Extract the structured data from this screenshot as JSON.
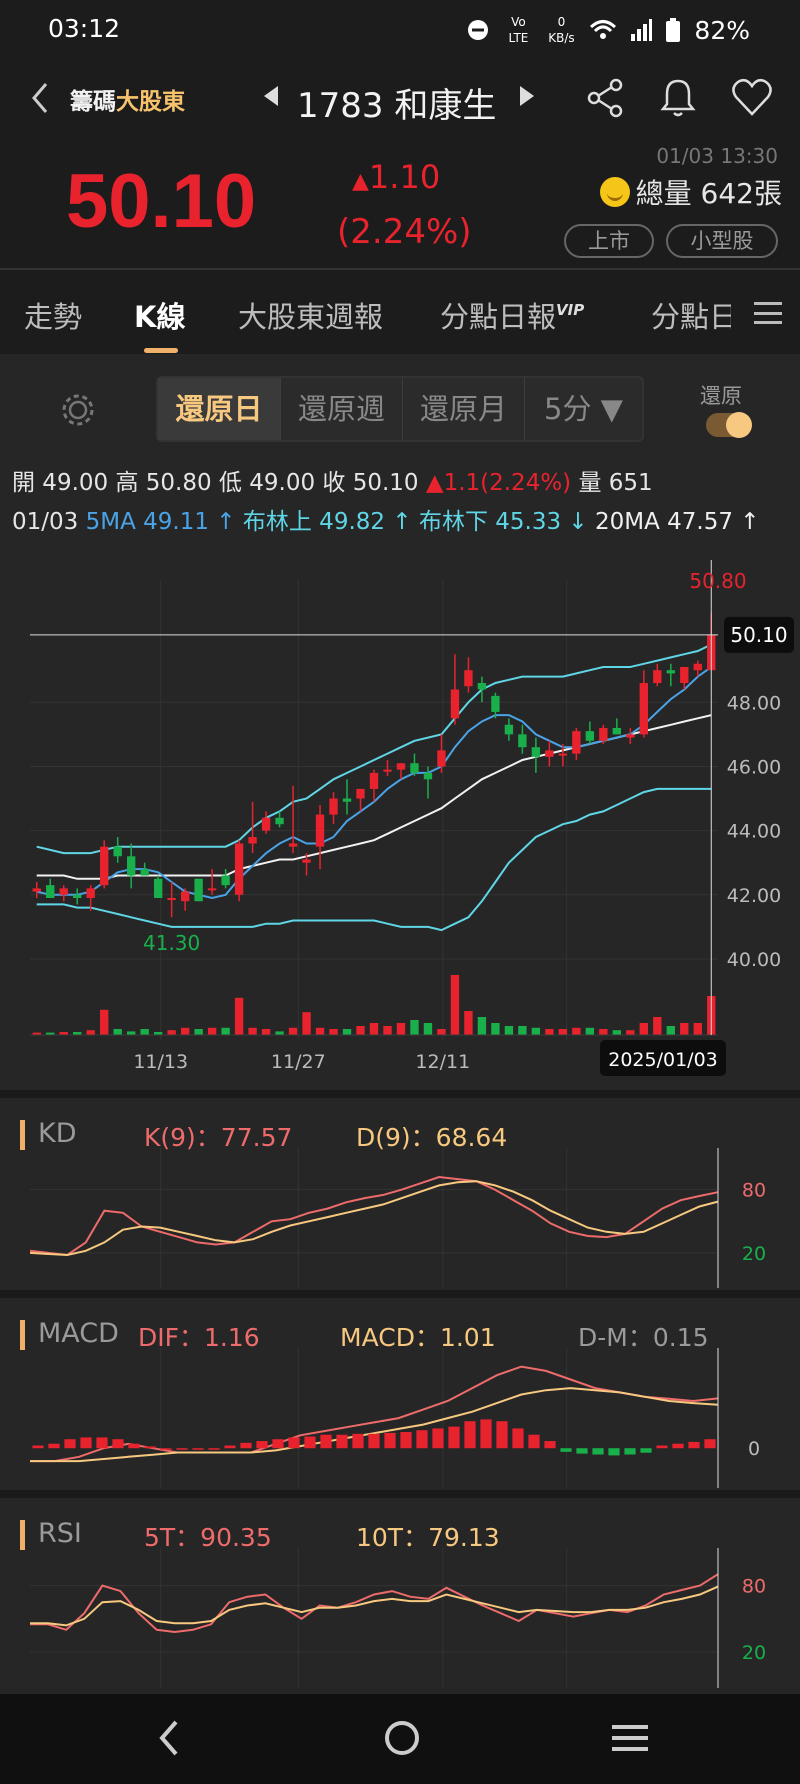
{
  "status": {
    "time": "03:12",
    "net1": "Vo LTE",
    "net2": "0 KB/s",
    "battery": "82%"
  },
  "header": {
    "brand_a": "籌碼",
    "brand_b": "大股東",
    "stock": "1783 和康生"
  },
  "quote": {
    "price": "50.10",
    "change": "1.10",
    "percent": "(2.24%)",
    "time": "01/03 13:30",
    "volume": "總量  642張",
    "tag1": "上市",
    "tag2": "小型股"
  },
  "tabs": [
    "走勢",
    "K線",
    "大股東週報",
    "分點日報",
    "VIP",
    "分點日"
  ],
  "segments": {
    "s1": "還原日",
    "s2": "還原週",
    "s3": "還原月",
    "s4": "5分 ▼",
    "restore": "還原"
  },
  "info": {
    "ohlc": "開 49.00 高 50.80 低 49.00 收 50.10 ",
    "chg": "▲1.1(2.24%)",
    "vol": " 量 651",
    "date": "01/03",
    "ma5": "5MA 49.11 ↑",
    "bbu": "布林上 49.82 ↑",
    "bbl": "布林下 45.33 ↓",
    "ma20": "20MA 47.57 ↑"
  },
  "kd": {
    "title": "KD",
    "k": "K(9)：77.57",
    "d": "D(9)：68.64",
    "t80": "80",
    "t20": "20"
  },
  "macd": {
    "title": "MACD",
    "dif": "DIF：1.16",
    "macd": "MACD：1.01",
    "dm": "D-M：0.15",
    "t0": "0"
  },
  "rsi": {
    "title": "RSI",
    "r5": "5T：90.35",
    "r10": "10T：79.13",
    "t80": "80",
    "t20": "20"
  },
  "colors": {
    "up": "#e8232e",
    "down": "#19b04b",
    "accent": "#f0b26a"
  },
  "chart_data": {
    "type": "candlestick",
    "y_ticks": [
      "48.00",
      "46.00",
      "44.00",
      "42.00",
      "40.00"
    ],
    "x_ticks": [
      "11/13",
      "11/27",
      "12/11"
    ],
    "crosshair_date": "2025/01/03",
    "last_price": "50.10",
    "high_label": "50.80",
    "low_label": "41.30",
    "ylim": [
      39.5,
      51.5
    ],
    "candles": [
      {
        "o": 42.1,
        "h": 42.4,
        "l": 41.9,
        "c": 42.2
      },
      {
        "o": 42.3,
        "h": 42.5,
        "l": 41.9,
        "c": 41.9
      },
      {
        "o": 42.0,
        "h": 42.3,
        "l": 41.8,
        "c": 42.2
      },
      {
        "o": 42.0,
        "h": 42.2,
        "l": 41.7,
        "c": 41.9
      },
      {
        "o": 41.9,
        "h": 42.3,
        "l": 41.5,
        "c": 42.2
      },
      {
        "o": 42.3,
        "h": 43.7,
        "l": 42.2,
        "c": 43.5
      },
      {
        "o": 43.5,
        "h": 43.8,
        "l": 43.0,
        "c": 43.2
      },
      {
        "o": 43.2,
        "h": 43.6,
        "l": 42.2,
        "c": 42.6
      },
      {
        "o": 42.8,
        "h": 43.0,
        "l": 42.6,
        "c": 42.6
      },
      {
        "o": 42.5,
        "h": 42.6,
        "l": 41.9,
        "c": 41.9
      },
      {
        "o": 41.9,
        "h": 42.4,
        "l": 41.3,
        "c": 41.9
      },
      {
        "o": 41.8,
        "h": 42.2,
        "l": 41.5,
        "c": 42.1
      },
      {
        "o": 42.5,
        "h": 42.5,
        "l": 41.8,
        "c": 41.8
      },
      {
        "o": 42.2,
        "h": 42.8,
        "l": 42.0,
        "c": 42.2
      },
      {
        "o": 42.6,
        "h": 42.8,
        "l": 42.2,
        "c": 42.3
      },
      {
        "o": 42.0,
        "h": 43.7,
        "l": 41.8,
        "c": 43.6
      },
      {
        "o": 43.6,
        "h": 44.9,
        "l": 43.3,
        "c": 43.8
      },
      {
        "o": 44.0,
        "h": 44.6,
        "l": 43.9,
        "c": 44.4
      },
      {
        "o": 44.4,
        "h": 44.6,
        "l": 44.1,
        "c": 44.2
      },
      {
        "o": 43.5,
        "h": 45.4,
        "l": 43.3,
        "c": 43.6
      },
      {
        "o": 43.0,
        "h": 43.3,
        "l": 42.6,
        "c": 43.1
      },
      {
        "o": 43.5,
        "h": 44.8,
        "l": 42.8,
        "c": 44.5
      },
      {
        "o": 44.5,
        "h": 45.2,
        "l": 44.2,
        "c": 45.0
      },
      {
        "o": 45.0,
        "h": 45.6,
        "l": 44.5,
        "c": 44.9
      },
      {
        "o": 45.0,
        "h": 45.3,
        "l": 44.6,
        "c": 45.3
      },
      {
        "o": 45.3,
        "h": 45.9,
        "l": 44.9,
        "c": 45.8
      },
      {
        "o": 45.9,
        "h": 46.2,
        "l": 45.7,
        "c": 45.9
      },
      {
        "o": 45.9,
        "h": 46.1,
        "l": 45.6,
        "c": 46.1
      },
      {
        "o": 46.1,
        "h": 46.4,
        "l": 45.7,
        "c": 45.8
      },
      {
        "o": 45.8,
        "h": 46.0,
        "l": 45.0,
        "c": 45.6
      },
      {
        "o": 46.0,
        "h": 47.0,
        "l": 45.8,
        "c": 46.5
      },
      {
        "o": 47.5,
        "h": 49.5,
        "l": 47.3,
        "c": 48.4
      },
      {
        "o": 48.5,
        "h": 49.4,
        "l": 48.3,
        "c": 49.0
      },
      {
        "o": 48.6,
        "h": 48.8,
        "l": 48.0,
        "c": 48.4
      },
      {
        "o": 48.2,
        "h": 48.3,
        "l": 47.5,
        "c": 47.7
      },
      {
        "o": 47.3,
        "h": 47.5,
        "l": 46.8,
        "c": 47.0
      },
      {
        "o": 47.0,
        "h": 47.3,
        "l": 46.4,
        "c": 46.6
      },
      {
        "o": 46.6,
        "h": 46.9,
        "l": 45.8,
        "c": 46.3
      },
      {
        "o": 46.3,
        "h": 46.8,
        "l": 46.0,
        "c": 46.5
      },
      {
        "o": 46.4,
        "h": 46.7,
        "l": 46.0,
        "c": 46.4
      },
      {
        "o": 46.4,
        "h": 47.2,
        "l": 46.2,
        "c": 47.1
      },
      {
        "o": 47.1,
        "h": 47.4,
        "l": 46.7,
        "c": 46.8
      },
      {
        "o": 46.8,
        "h": 47.3,
        "l": 46.7,
        "c": 47.2
      },
      {
        "o": 47.2,
        "h": 47.5,
        "l": 47.0,
        "c": 47.0
      },
      {
        "o": 46.9,
        "h": 47.2,
        "l": 46.7,
        "c": 47.0
      },
      {
        "o": 47.0,
        "h": 49.0,
        "l": 46.9,
        "c": 48.6
      },
      {
        "o": 48.6,
        "h": 49.2,
        "l": 48.5,
        "c": 49.0
      },
      {
        "o": 49.0,
        "h": 49.2,
        "l": 48.5,
        "c": 48.9
      },
      {
        "o": 48.6,
        "h": 49.1,
        "l": 48.4,
        "c": 49.1
      },
      {
        "o": 49.0,
        "h": 49.3,
        "l": 48.8,
        "c": 49.2
      },
      {
        "o": 49.0,
        "h": 50.8,
        "l": 49.0,
        "c": 50.1
      }
    ],
    "ma5": [
      42.1,
      42.0,
      42.0,
      42.0,
      42.1,
      42.4,
      42.7,
      42.8,
      42.8,
      42.7,
      42.4,
      42.1,
      42.0,
      41.9,
      42.0,
      42.5,
      42.9,
      43.3,
      43.6,
      43.8,
      43.6,
      43.6,
      43.8,
      44.3,
      44.6,
      44.9,
      45.3,
      45.6,
      45.8,
      45.8,
      46.0,
      46.6,
      47.1,
      47.4,
      47.6,
      47.6,
      47.4,
      47.0,
      46.8,
      46.6,
      46.6,
      46.7,
      46.8,
      46.9,
      47.0,
      47.3,
      47.7,
      48.1,
      48.4,
      48.8,
      49.1
    ],
    "bbu": [
      43.5,
      43.4,
      43.3,
      43.3,
      43.3,
      43.4,
      43.5,
      43.5,
      43.5,
      43.5,
      43.5,
      43.5,
      43.5,
      43.5,
      43.5,
      43.7,
      44.1,
      44.4,
      44.6,
      44.9,
      45.0,
      45.3,
      45.6,
      45.8,
      46.0,
      46.2,
      46.4,
      46.6,
      46.8,
      46.9,
      47.0,
      47.5,
      48.0,
      48.4,
      48.6,
      48.7,
      48.8,
      48.8,
      48.8,
      48.8,
      48.9,
      49.0,
      49.1,
      49.1,
      49.1,
      49.2,
      49.3,
      49.4,
      49.5,
      49.6,
      49.8
    ],
    "ma20": [
      42.6,
      42.6,
      42.6,
      42.5,
      42.5,
      42.5,
      42.6,
      42.6,
      42.6,
      42.6,
      42.6,
      42.6,
      42.6,
      42.6,
      42.6,
      42.8,
      42.9,
      43.0,
      43.1,
      43.1,
      43.2,
      43.3,
      43.4,
      43.5,
      43.6,
      43.7,
      43.9,
      44.1,
      44.3,
      44.5,
      44.7,
      45.0,
      45.3,
      45.6,
      45.8,
      46.0,
      46.2,
      46.3,
      46.4,
      46.5,
      46.6,
      46.7,
      46.8,
      46.9,
      47.0,
      47.1,
      47.2,
      47.3,
      47.4,
      47.5,
      47.6
    ],
    "bbl": [
      41.7,
      41.7,
      41.7,
      41.6,
      41.6,
      41.5,
      41.4,
      41.3,
      41.2,
      41.1,
      41.0,
      41.0,
      41.0,
      41.0,
      41.0,
      41.0,
      41.0,
      41.1,
      41.1,
      41.2,
      41.2,
      41.2,
      41.2,
      41.2,
      41.2,
      41.2,
      41.1,
      41.0,
      41.0,
      41.0,
      40.9,
      41.1,
      41.3,
      41.8,
      42.4,
      43.0,
      43.4,
      43.8,
      44.0,
      44.2,
      44.3,
      44.5,
      44.6,
      44.8,
      45.0,
      45.2,
      45.3,
      45.3,
      45.3,
      45.3,
      45.3
    ],
    "volume": [
      0.04,
      0.04,
      0.05,
      0.05,
      0.08,
      0.42,
      0.1,
      0.06,
      0.1,
      0.05,
      0.08,
      0.12,
      0.1,
      0.12,
      0.12,
      0.62,
      0.12,
      0.1,
      0.06,
      0.12,
      0.38,
      0.12,
      0.1,
      0.1,
      0.15,
      0.2,
      0.15,
      0.2,
      0.25,
      0.2,
      0.1,
      1.0,
      0.4,
      0.3,
      0.2,
      0.15,
      0.15,
      0.12,
      0.1,
      0.1,
      0.12,
      0.12,
      0.1,
      0.08,
      0.08,
      0.2,
      0.3,
      0.15,
      0.2,
      0.2,
      0.65
    ],
    "kd_k": [
      22,
      20,
      18,
      30,
      60,
      58,
      45,
      40,
      35,
      30,
      28,
      30,
      40,
      50,
      52,
      58,
      62,
      68,
      72,
      75,
      80,
      86,
      92,
      90,
      88,
      80,
      70,
      60,
      48,
      40,
      36,
      35,
      38,
      50,
      62,
      70,
      74,
      77.57
    ],
    "kd_d": [
      20,
      19,
      18,
      22,
      30,
      42,
      45,
      44,
      40,
      36,
      32,
      30,
      33,
      40,
      46,
      50,
      54,
      58,
      62,
      66,
      72,
      78,
      84,
      87,
      88,
      84,
      78,
      70,
      60,
      52,
      44,
      40,
      38,
      40,
      48,
      56,
      64,
      68.64
    ],
    "macd_dif": [
      -0.3,
      -0.3,
      -0.2,
      0.0,
      0.1,
      0.0,
      -0.1,
      -0.1,
      -0.1,
      -0.1,
      0.1,
      0.3,
      0.4,
      0.5,
      0.6,
      0.7,
      0.9,
      1.1,
      1.4,
      1.7,
      1.9,
      1.8,
      1.6,
      1.4,
      1.3,
      1.2,
      1.15,
      1.1,
      1.16
    ],
    "macd_dem": [
      -0.3,
      -0.3,
      -0.3,
      -0.25,
      -0.2,
      -0.15,
      -0.1,
      -0.1,
      -0.1,
      -0.1,
      -0.05,
      0.05,
      0.15,
      0.25,
      0.35,
      0.45,
      0.55,
      0.7,
      0.85,
      1.05,
      1.25,
      1.35,
      1.4,
      1.35,
      1.3,
      1.2,
      1.1,
      1.05,
      1.01
    ],
    "macd_hist": [
      0.03,
      0.05,
      0.1,
      0.12,
      0.12,
      0.1,
      0.05,
      0.02,
      0.0,
      0.0,
      0.0,
      0.0,
      0.03,
      0.06,
      0.08,
      0.1,
      0.12,
      0.13,
      0.15,
      0.15,
      0.16,
      0.16,
      0.17,
      0.18,
      0.2,
      0.22,
      0.24,
      0.3,
      0.32,
      0.3,
      0.22,
      0.15,
      0.08,
      -0.04,
      -0.06,
      -0.07,
      -0.08,
      -0.07,
      -0.05,
      0.03,
      0.05,
      0.07,
      0.1
    ],
    "rsi5": [
      45,
      45,
      40,
      55,
      80,
      75,
      55,
      40,
      38,
      40,
      45,
      65,
      70,
      72,
      60,
      50,
      62,
      60,
      65,
      72,
      75,
      70,
      68,
      78,
      70,
      62,
      55,
      48,
      58,
      55,
      52,
      55,
      58,
      56,
      62,
      72,
      76,
      80,
      90.35
    ],
    "rsi10": [
      46,
      46,
      44,
      50,
      65,
      66,
      58,
      48,
      46,
      46,
      48,
      58,
      62,
      64,
      60,
      56,
      60,
      60,
      62,
      66,
      68,
      66,
      66,
      72,
      68,
      64,
      60,
      56,
      58,
      57,
      56,
      56,
      58,
      58,
      60,
      65,
      68,
      72,
      79.13
    ]
  }
}
